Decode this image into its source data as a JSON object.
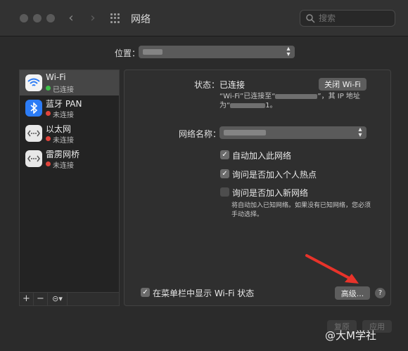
{
  "window": {
    "title": "网络"
  },
  "search": {
    "placeholder": "搜索"
  },
  "location": {
    "label": "位置："
  },
  "services": [
    {
      "name": "Wi-Fi",
      "status": "已连接",
      "status_color": "#3fc04a",
      "icon": "wifi-icon",
      "selected": true
    },
    {
      "name": "蓝牙 PAN",
      "status": "未连接",
      "status_color": "#e0443b",
      "icon": "bluetooth-icon",
      "selected": false
    },
    {
      "name": "以太网",
      "status": "未连接",
      "status_color": "#e0443b",
      "icon": "ethernet-icon",
      "selected": false
    },
    {
      "name": "雷雳网桥",
      "status": "未连接",
      "status_color": "#e0443b",
      "icon": "thunderbolt-bridge-icon",
      "selected": false
    }
  ],
  "list_controls": {
    "add": "+",
    "remove": "−",
    "action": "⊝▾"
  },
  "detail": {
    "status_label": "状态：",
    "status_value": "已连接",
    "turn_off_button": "关闭 Wi-Fi",
    "status_desc_part1": "“Wi-Fi”已连接至“",
    "status_desc_part2": "”，其 IP 地址",
    "status_desc_part3": "为“",
    "status_desc_part4": "1。",
    "network_name_label": "网络名称：",
    "auto_join": "自动加入此网络",
    "ask_hotspot": "询问是否加入个人热点",
    "ask_new_networks": "询问是否加入新网络",
    "ask_new_networks_desc": "将自动加入已知网络。如果没有已知网络，您必须手动选择。",
    "show_in_menubar": "在菜单栏中显示 Wi-Fi 状态",
    "advanced_button": "高级...",
    "help_button": "?"
  },
  "footer": {
    "revert": "复原",
    "apply": "应用"
  },
  "watermark": {
    "text": "@大M学社"
  },
  "colors": {
    "accent_blue": "#2c7cf6",
    "arrow_red": "#e8332a"
  }
}
